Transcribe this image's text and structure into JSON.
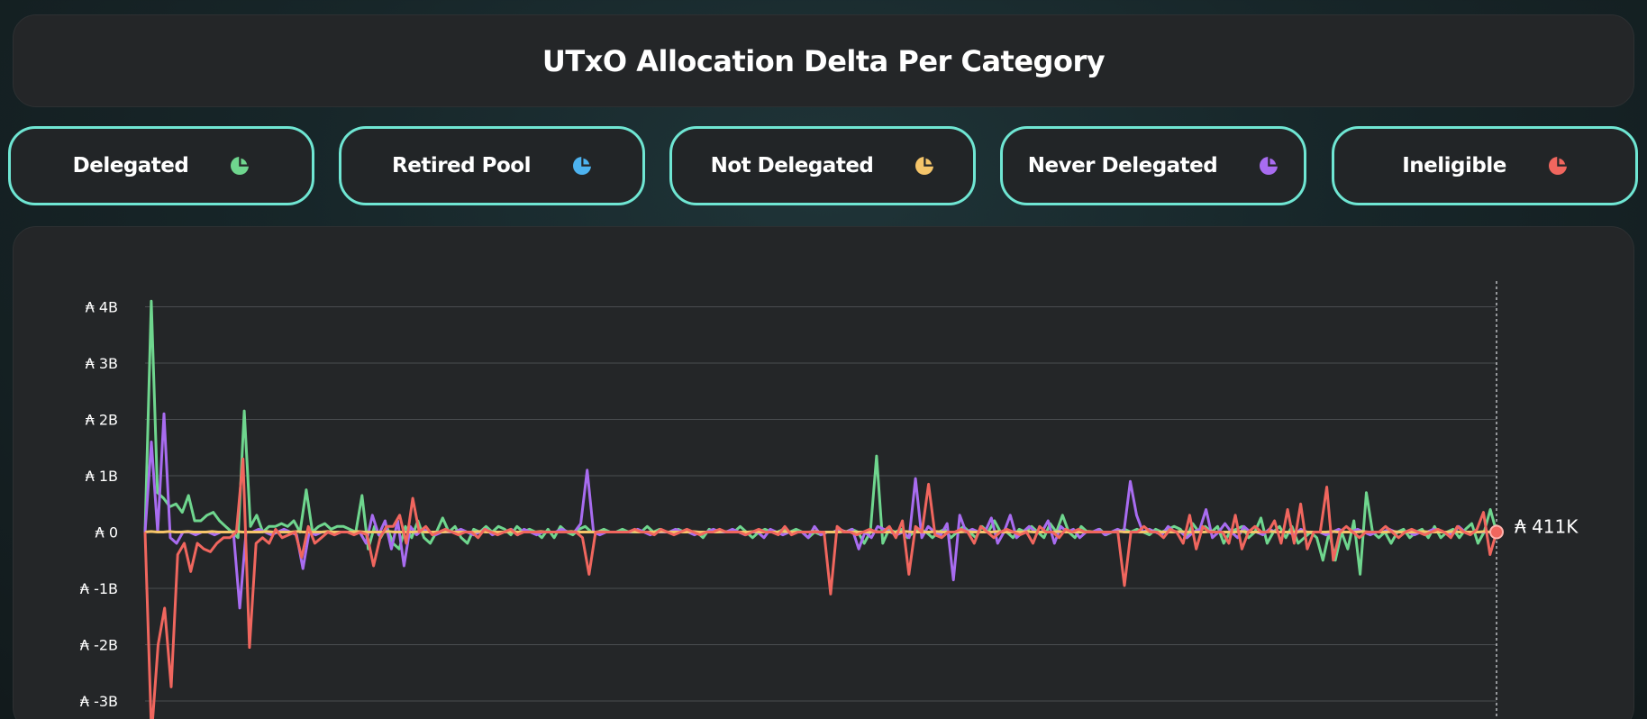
{
  "title": "UTxO Allocation Delta Per Category",
  "categories": [
    {
      "label": "Delegated",
      "icon": "pie-chart-icon",
      "color": "#6fd68e"
    },
    {
      "label": "Retired Pool",
      "icon": "pie-chart-icon",
      "color": "#4db3f0"
    },
    {
      "label": "Not Delegated",
      "icon": "pie-chart-icon",
      "color": "#f5c56a"
    },
    {
      "label": "Never Delegated",
      "icon": "pie-chart-icon",
      "color": "#a86cf0"
    },
    {
      "label": "Ineligible",
      "icon": "pie-chart-icon",
      "color": "#f0665e"
    }
  ],
  "chart_data": {
    "type": "line",
    "title": "",
    "xlabel": "",
    "ylabel": "",
    "grid": true,
    "y_ticks": [
      "₳ 4B",
      "₳ 3B",
      "₳ 2B",
      "₳ 1B",
      "₳ 0",
      "₳ -1B",
      "₳ -2B",
      "₳ -3B"
    ],
    "y_tick_values": [
      4000000000,
      3000000000,
      2000000000,
      1000000000,
      0,
      -1000000000,
      -2000000000,
      -3000000000
    ],
    "ylim": [
      -3200000000,
      4200000000
    ],
    "end_value_label": "₳ 411K",
    "series": [
      {
        "name": "Delegated",
        "color": "#6fd68e",
        "values": [
          0.0,
          4.1,
          0.7,
          0.6,
          0.45,
          0.5,
          0.35,
          0.65,
          0.2,
          0.2,
          0.3,
          0.35,
          0.2,
          0.1,
          0.0,
          -0.1,
          2.15,
          0.1,
          0.3,
          0.0,
          0.1,
          0.1,
          0.15,
          0.1,
          0.2,
          0.0,
          0.75,
          0.0,
          0.1,
          0.15,
          0.05,
          0.1,
          0.1,
          0.05,
          0.0,
          0.65,
          -0.3,
          0.1,
          -0.1,
          0.1,
          -0.2,
          -0.3,
          0.1,
          -0.1,
          0.2,
          -0.1,
          -0.2,
          0.0,
          0.25,
          0.0,
          0.1,
          -0.1,
          -0.2,
          0.05,
          0.0,
          0.1,
          0.0,
          0.1,
          0.05,
          -0.05,
          0.1,
          0.0,
          0.05,
          0.0,
          -0.1,
          0.05,
          -0.1,
          0.1,
          0.0,
          -0.05,
          0.05,
          0.1,
          0.0,
          0.0,
          0.05,
          0.0,
          0.0,
          0.05,
          0.0,
          0.0,
          0.0,
          0.1,
          0.0,
          0.05,
          0.0,
          0.0,
          0.05,
          0.0,
          0.0,
          0.0,
          -0.1,
          0.05,
          0.0,
          0.0,
          0.0,
          0.0,
          0.1,
          0.0,
          -0.1,
          0.0,
          0.05,
          0.0,
          0.0,
          0.05,
          0.0,
          0.05,
          0.0,
          -0.1,
          0.0,
          -0.05,
          0.0,
          0.0,
          0.05,
          0.0,
          0.05,
          0.0,
          -0.2,
          0.0,
          1.35,
          -0.2,
          0.05,
          0.0,
          0.05,
          -0.1,
          0.0,
          0.05,
          0.0,
          -0.1,
          0.0,
          0.05,
          -0.1,
          0.0,
          0.1,
          0.0,
          -0.1,
          0.1,
          0.0,
          0.2,
          0.0,
          0.0,
          -0.1,
          0.05,
          0.0,
          0.1,
          0.0,
          -0.1,
          0.15,
          0.0,
          0.3,
          0.0,
          -0.1,
          0.1,
          0.0,
          0.0,
          0.05,
          -0.05,
          0.0,
          0.0,
          0.05,
          0.0,
          0.05,
          0.0,
          -0.05,
          0.05,
          0.0,
          0.05,
          0.1,
          0.05,
          -0.1,
          0.15,
          0.0,
          0.1,
          0.0,
          0.1,
          -0.2,
          0.0,
          0.05,
          0.1,
          -0.1,
          0.0,
          0.25,
          -0.2,
          0.0,
          0.1,
          -0.1,
          0.1,
          -0.2,
          -0.1,
          0.0,
          -0.1,
          -0.5,
          0.0,
          -0.5,
          0.0,
          -0.3,
          0.2,
          -0.75,
          0.7,
          0.0,
          -0.1,
          0.0,
          -0.2,
          0.0,
          0.05,
          -0.1,
          0.0,
          0.05,
          -0.1,
          0.1,
          -0.1,
          0.0,
          0.05,
          -0.1,
          0.05,
          0.15,
          -0.2,
          0.0,
          0.4,
          0.0
        ]
      },
      {
        "name": "Never Delegated",
        "color": "#a86cf0",
        "values": [
          0.0,
          1.6,
          0.0,
          2.1,
          -0.1,
          -0.2,
          0.0,
          0.0,
          -0.05,
          0.0,
          0.0,
          -0.05,
          0.0,
          0.0,
          0.0,
          -1.35,
          0.0,
          0.0,
          0.05,
          0.0,
          -0.05,
          0.0,
          0.05,
          0.0,
          -0.05,
          -0.65,
          0.0,
          -0.05,
          0.0,
          0.0,
          -0.05,
          0.0,
          0.0,
          0.0,
          0.0,
          -0.2,
          0.3,
          -0.05,
          0.2,
          -0.3,
          0.2,
          -0.6,
          0.1,
          -0.05,
          0.05,
          0.0,
          -0.05,
          0.0,
          0.0,
          0.0,
          0.05,
          0.0,
          -0.05,
          0.0,
          0.05,
          -0.05,
          0.0,
          0.0,
          0.05,
          -0.05,
          0.05,
          0.0,
          -0.05,
          0.0,
          0.0,
          0.0,
          0.05,
          0.0,
          0.0,
          0.15,
          1.1,
          0.0,
          -0.05,
          0.0,
          0.0,
          0.0,
          0.0,
          0.0,
          0.05,
          0.0,
          -0.05,
          0.0,
          0.0,
          0.0,
          0.05,
          0.0,
          0.0,
          -0.05,
          0.0,
          0.0,
          0.05,
          0.0,
          0.0,
          0.05,
          0.0,
          -0.05,
          0.0,
          0.0,
          -0.1,
          0.05,
          0.0,
          -0.05,
          0.0,
          0.0,
          0.0,
          -0.1,
          0.1,
          -0.05,
          0.0,
          0.0,
          0.05,
          0.0,
          0.05,
          -0.3,
          0.0,
          -0.1,
          0.1,
          0.05,
          0.0,
          -0.05,
          0.0,
          -0.1,
          0.95,
          -0.1,
          0.1,
          0.0,
          -0.05,
          0.15,
          -0.85,
          0.3,
          0.0,
          0.05,
          0.0,
          0.0,
          0.25,
          -0.2,
          0.0,
          0.3,
          -0.1,
          0.0,
          0.1,
          0.0,
          0.0,
          0.2,
          -0.2,
          0.1,
          0.0,
          0.05,
          -0.1,
          0.0,
          0.0,
          0.05,
          -0.05,
          0.0,
          0.05,
          0.0,
          0.9,
          0.3,
          0.0,
          0.05,
          0.0,
          -0.05,
          0.1,
          0.0,
          0.0,
          -0.1,
          0.0,
          0.05,
          0.4,
          -0.1,
          0.0,
          0.15,
          0.0,
          -0.1,
          0.1,
          0.0,
          0.0,
          -0.05,
          0.05,
          0.0,
          0.0,
          0.0,
          -0.05,
          0.05,
          0.0,
          0.0,
          0.0,
          -0.05,
          0.0,
          0.05,
          0.0,
          0.0,
          0.05,
          0.0,
          -0.05,
          0.0,
          0.0,
          0.05,
          0.0,
          0.0,
          0.0,
          -0.05,
          0.0,
          0.0,
          0.05,
          0.0,
          0.0,
          -0.05,
          0.1,
          0.0,
          0.0,
          0.0,
          0.0,
          0.0,
          0.0
        ]
      },
      {
        "name": "Not Delegated",
        "color": "#f5c56a",
        "values": [
          0.0,
          0.01,
          0.0,
          0.0,
          0.01,
          0.0,
          0.0,
          0.01,
          0.0,
          0.0,
          0.0,
          0.01,
          0.0,
          0.0,
          0.0,
          0.01,
          0.0,
          0.0,
          0.0,
          0.0,
          0.01,
          0.0,
          0.0,
          0.0,
          0.0,
          0.01,
          0.0,
          0.0,
          0.0,
          0.0,
          0.01,
          0.0,
          0.0,
          0.0,
          0.0,
          0.01,
          0.0,
          0.0,
          0.0,
          0.0,
          0.01,
          0.0,
          0.0,
          0.0,
          0.0,
          0.01,
          0.0,
          0.0,
          0.0,
          0.0,
          0.01,
          0.0,
          0.0,
          0.0,
          0.0,
          0.01,
          0.0,
          0.0,
          0.0,
          0.0,
          0.01,
          0.0,
          0.0,
          0.0,
          0.0,
          0.01,
          0.0,
          0.0,
          0.0,
          0.0,
          0.01,
          0.0,
          0.0,
          0.0,
          0.0,
          0.01,
          0.0,
          0.0,
          0.0,
          0.0,
          0.01,
          0.0,
          0.0,
          0.0,
          0.0,
          0.01,
          0.0,
          0.0,
          0.0,
          0.0,
          0.01,
          0.0,
          0.0,
          0.0,
          0.0,
          0.01,
          0.0,
          0.0,
          0.0,
          0.0,
          0.01,
          0.0,
          0.0,
          0.0,
          0.0,
          0.01,
          0.0,
          0.0,
          0.0,
          0.0,
          0.01,
          0.0,
          0.0,
          0.0,
          0.0,
          0.01,
          0.0,
          0.0,
          0.0,
          0.0,
          0.01,
          0.0,
          0.0,
          0.0,
          0.0,
          0.01,
          0.0,
          0.0,
          0.0,
          0.0,
          0.01,
          0.0,
          0.0,
          0.0,
          0.0,
          0.01,
          0.0,
          0.0,
          0.0,
          0.0,
          0.01,
          0.0,
          0.0,
          0.0,
          0.0,
          0.01,
          0.0,
          0.0,
          0.0,
          0.0,
          0.01,
          0.0,
          0.0,
          0.0,
          0.0,
          0.01,
          0.0,
          0.0,
          0.0,
          0.0,
          0.01,
          0.0,
          0.0,
          0.0,
          0.0,
          0.01,
          0.0,
          0.0,
          0.0,
          0.0,
          0.01,
          0.0,
          0.0,
          0.0,
          0.0,
          0.01,
          0.0,
          0.0,
          0.0,
          0.0,
          0.01,
          0.0,
          0.0,
          0.0,
          0.0,
          0.01,
          0.0,
          0.0,
          0.0,
          0.0,
          0.01,
          0.0,
          0.0,
          0.0,
          0.0,
          0.01,
          0.0,
          0.0,
          0.0,
          0.0,
          0.01,
          0.0,
          0.0,
          0.0,
          0.0,
          0.01,
          0.0,
          0.0,
          0.0,
          0.0,
          0.01,
          0.0,
          0.0,
          0.0,
          0.0,
          0.01,
          0.0,
          0.0,
          0.0,
          0.0,
          0.01,
          0.0,
          0.0
        ]
      },
      {
        "name": "Ineligible",
        "color": "#f0665e",
        "values": [
          0.0,
          -3.6,
          -2.0,
          -1.35,
          -2.75,
          -0.4,
          -0.2,
          -0.7,
          -0.2,
          -0.3,
          -0.35,
          -0.2,
          -0.1,
          -0.1,
          0.0,
          1.3,
          -2.05,
          -0.2,
          -0.1,
          -0.2,
          0.05,
          -0.1,
          -0.05,
          0.0,
          -0.45,
          0.1,
          -0.2,
          -0.1,
          0.0,
          -0.05,
          0.0,
          0.0,
          -0.05,
          0.0,
          -0.05,
          -0.6,
          -0.1,
          0.1,
          0.1,
          0.3,
          -0.2,
          0.6,
          0.0,
          0.1,
          -0.05,
          0.0,
          0.05,
          0.0,
          -0.05,
          0.0,
          0.0,
          -0.1,
          0.05,
          0.0,
          -0.05,
          0.0,
          0.05,
          -0.05,
          0.0,
          0.0,
          0.0,
          0.0,
          0.0,
          0.0,
          0.0,
          0.0,
          0.0,
          -0.1,
          -0.75,
          0.0,
          0.0,
          0.0,
          0.0,
          0.0,
          0.0,
          0.05,
          0.0,
          0.0,
          -0.05,
          0.05,
          0.0,
          -0.05,
          0.0,
          0.05,
          0.0,
          -0.05,
          0.0,
          0.0,
          0.05,
          0.0,
          0.0,
          0.0,
          -0.05,
          0.0,
          0.05,
          0.0,
          0.0,
          -0.05,
          0.1,
          -0.05,
          0.0,
          0.0,
          0.0,
          0.0,
          0.0,
          -1.1,
          0.1,
          0.0,
          0.0,
          -0.05,
          0.0,
          0.05,
          0.0,
          0.0,
          0.1,
          -0.1,
          0.2,
          -0.75,
          0.1,
          0.0,
          0.85,
          -0.05,
          -0.1,
          0.0,
          0.0,
          0.05,
          0.0,
          -0.2,
          0.1,
          0.0,
          -0.1,
          0.0,
          0.05,
          0.0,
          -0.05,
          0.0,
          -0.2,
          0.1,
          0.0,
          0.0,
          -0.1,
          0.05,
          0.0,
          0.05,
          0.0,
          0.0,
          0.0,
          0.0,
          0.0,
          0.0,
          -0.95,
          0.0,
          0.0,
          0.1,
          0.0,
          0.0,
          -0.1,
          0.05,
          0.0,
          -0.2,
          0.3,
          -0.3,
          0.1,
          0.0,
          0.0,
          0.0,
          -0.2,
          0.3,
          -0.3,
          0.0,
          0.1,
          0.0,
          0.0,
          0.2,
          -0.2,
          0.4,
          -0.2,
          0.5,
          -0.3,
          0.0,
          0.0,
          0.8,
          -0.5,
          0.0,
          0.1,
          0.0,
          -0.1,
          0.0,
          0.0,
          0.0,
          0.1,
          0.0,
          -0.1,
          0.0,
          0.05,
          0.0,
          -0.05,
          0.0,
          0.05,
          0.0,
          -0.1,
          0.1,
          0.0,
          -0.05,
          0.05,
          0.35,
          -0.4,
          0.0
        ]
      }
    ]
  }
}
